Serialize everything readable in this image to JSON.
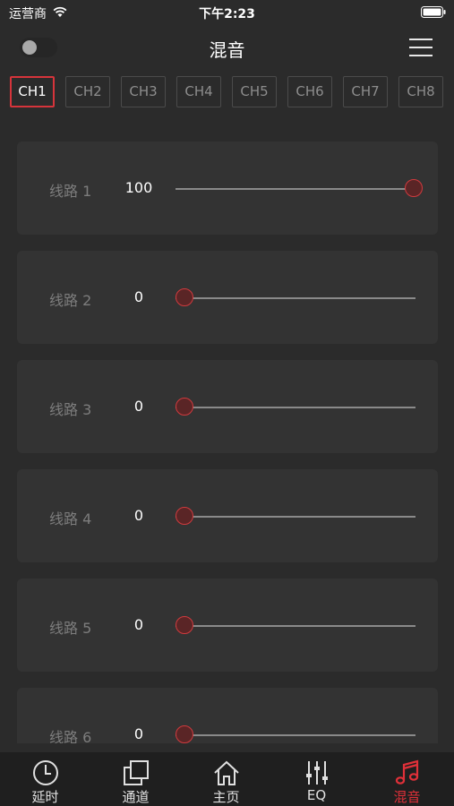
{
  "status_bar": {
    "carrier": "运营商",
    "time": "下午2:23"
  },
  "nav": {
    "title": "混音",
    "toggle_on": false
  },
  "channels": {
    "tabs": [
      "CH1",
      "CH2",
      "CH3",
      "CH4",
      "CH5",
      "CH6",
      "CH7",
      "CH8"
    ],
    "selected": "CH1"
  },
  "lines": [
    {
      "label": "线路 1",
      "value": "100",
      "level": 100
    },
    {
      "label": "线路 2",
      "value": "0",
      "level": 0
    },
    {
      "label": "线路 3",
      "value": "0",
      "level": 0
    },
    {
      "label": "线路 4",
      "value": "0",
      "level": 0
    },
    {
      "label": "线路 5",
      "value": "0",
      "level": 0
    },
    {
      "label": "线路 6",
      "value": "0",
      "level": 0
    }
  ],
  "tab_bar": {
    "items": [
      {
        "label": "延时",
        "icon": "clock-icon"
      },
      {
        "label": "通道",
        "icon": "squares-icon"
      },
      {
        "label": "主页",
        "icon": "home-icon"
      },
      {
        "label": "EQ",
        "icon": "equalizer-icon"
      },
      {
        "label": "混音",
        "icon": "music-note-icon"
      }
    ],
    "active": "混音"
  },
  "colors": {
    "accent": "#e03039",
    "background": "#2b2b2b",
    "card": "#333333",
    "tab_bar": "#1f1f1f"
  }
}
